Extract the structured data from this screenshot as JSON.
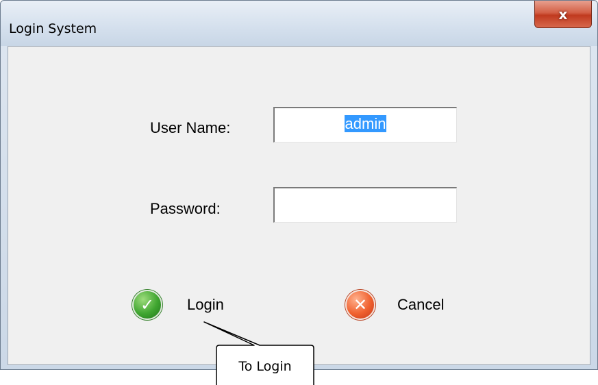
{
  "window": {
    "title": "Login System",
    "close_glyph": "x"
  },
  "form": {
    "username_label": "User Name:",
    "username_value": "admin",
    "password_label": "Password:",
    "password_value": ""
  },
  "buttons": {
    "login_label": "Login",
    "login_icon": "check-circle-icon",
    "cancel_label": "Cancel",
    "cancel_icon": "x-circle-icon"
  },
  "annotation": {
    "callout_text": "To Login"
  },
  "colors": {
    "selection": "#3399ff",
    "login_icon": "#3fa530",
    "cancel_icon": "#f0612f",
    "close_button": "#c03a1f"
  }
}
